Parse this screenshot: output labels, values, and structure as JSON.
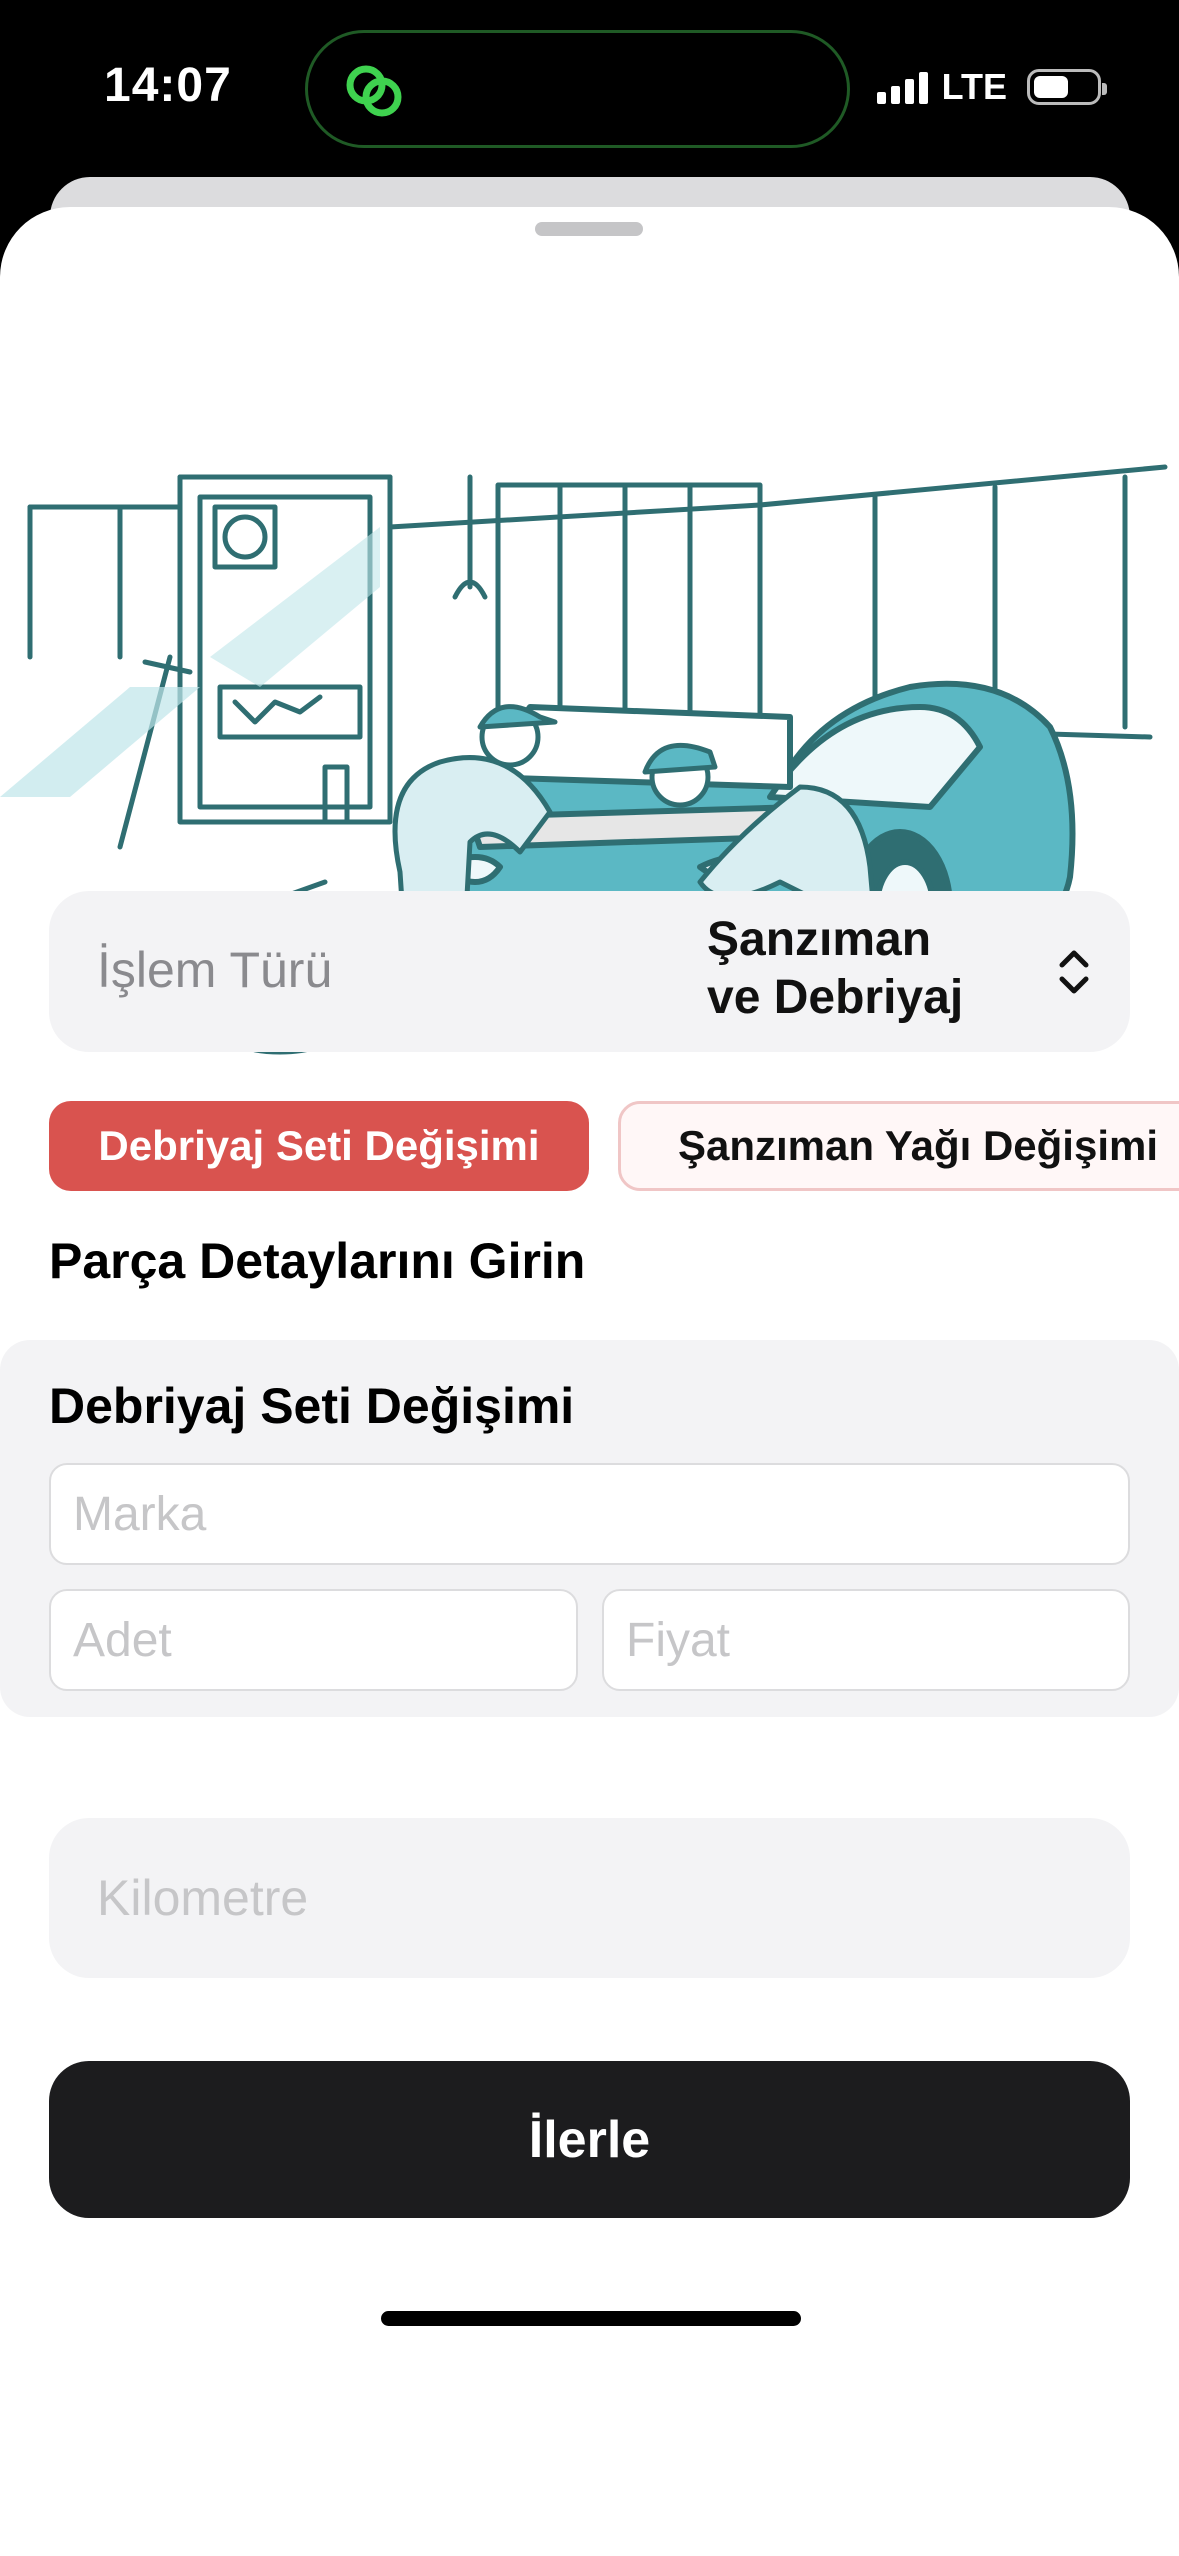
{
  "status_bar": {
    "time": "14:07",
    "network": "LTE",
    "island_icon": "link-rings-icon",
    "island_icon_color": "#3fd24f"
  },
  "illustration": {
    "icon": "mechanics-repairing-car-illustration",
    "accent_color": "#5bb8c4",
    "line_color": "#2f6e72"
  },
  "picker": {
    "label": "İşlem Türü",
    "value_line1": "Şanzıman",
    "value_line2": "ve Debriyaj",
    "icon": "chevron-up-down-icon"
  },
  "chips": [
    {
      "label": "Debriyaj Seti Değişimi",
      "selected": true,
      "color": "#d9534f"
    },
    {
      "label": "Şanzıman Yağı Değişimi",
      "selected": false
    }
  ],
  "section": {
    "title": "Parça Detaylarını Girin"
  },
  "card": {
    "title": "Debriyaj Seti Değişimi",
    "brand_placeholder": "Marka",
    "quantity_placeholder": "Adet",
    "price_placeholder": "Fiyat"
  },
  "mileage": {
    "placeholder": "Kilometre"
  },
  "cta": {
    "label": "İlerle"
  }
}
